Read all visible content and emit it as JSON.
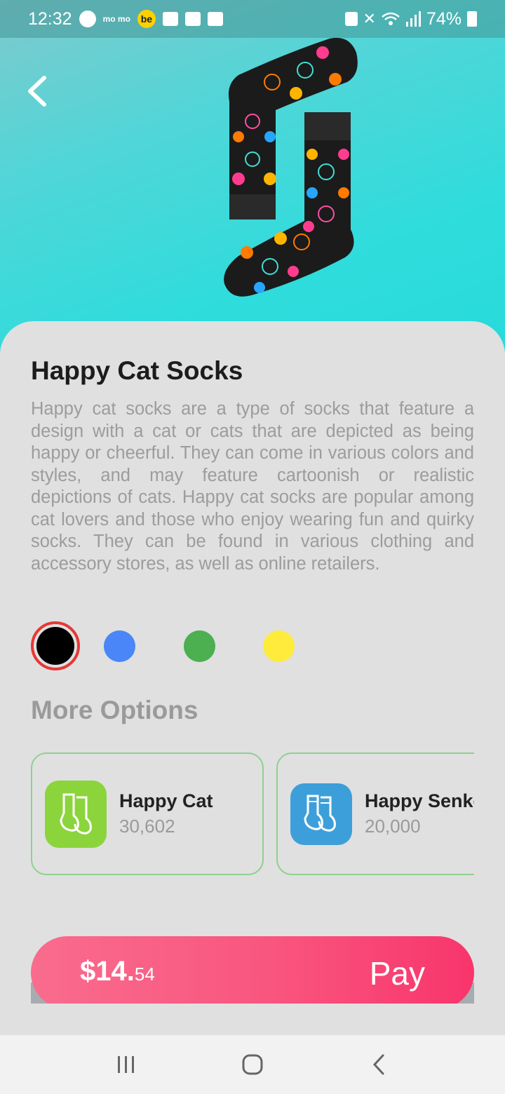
{
  "status_bar": {
    "time": "12:32",
    "momo_text": "mo mo",
    "be_text": "be",
    "battery": "74%"
  },
  "product": {
    "image_icon": "cat-socks-image",
    "title": "Happy Cat Socks",
    "description": "Happy cat socks are a type of socks that feature a design with a cat or cats that are depicted as being happy or cheerful. They can come in various colors and styles, and may feature cartoonish or realistic depictions of cats. Happy cat socks are popular among cat lovers and those who enjoy wearing fun and quirky socks. They can be found in various clothing and accessory stores, as well as online retailers."
  },
  "colors": {
    "options": [
      "#000000",
      "#4a86f7",
      "#4caf50",
      "#ffeb3b"
    ],
    "selected_index": 0,
    "selected_ring": "#e53935"
  },
  "more_options": {
    "title": "More Options",
    "items": [
      {
        "name": "Happy Cat",
        "count": "30,602",
        "icon": "socks-icon",
        "color": "#8bd43c"
      },
      {
        "name": "Happy Senko",
        "count": "20,000",
        "icon": "striped-socks-icon",
        "color": "#3d9fd9"
      }
    ]
  },
  "checkout": {
    "price_main": "$14.",
    "price_cents": "54",
    "pay_label": "Pay"
  },
  "nav": {
    "recents_icon": "recents-icon",
    "home_icon": "home-icon",
    "back_icon": "back-icon"
  }
}
